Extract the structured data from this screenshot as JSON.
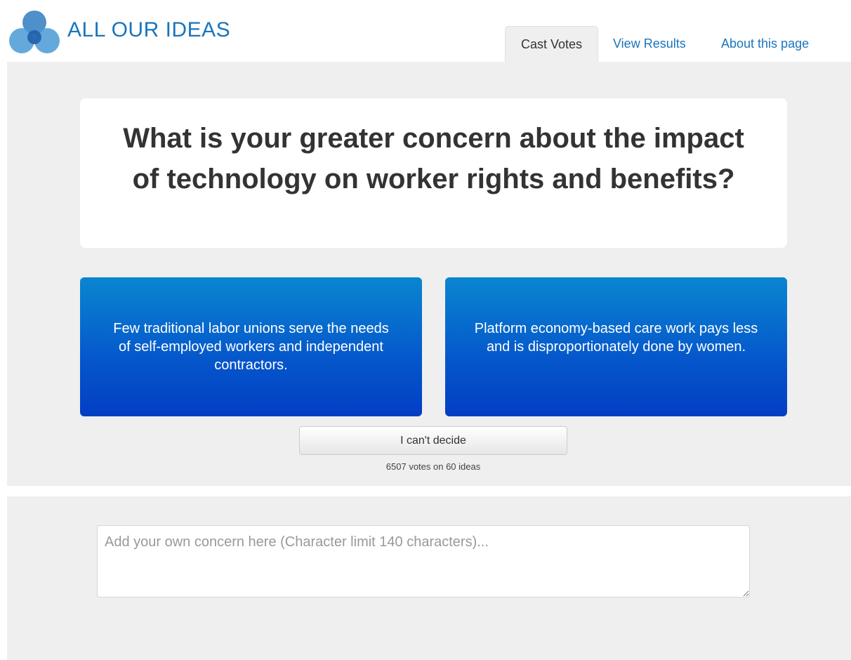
{
  "header": {
    "brand": "ALL OUR IDEAS",
    "logo_icon": "trefoil-logo-icon",
    "tabs": {
      "cast_votes": "Cast Votes",
      "view_results": "View Results",
      "about": "About this page"
    }
  },
  "question": {
    "text": "What is your greater concern about the impact of technology on worker rights and benefits?"
  },
  "choices": {
    "left": "Few traditional labor unions serve the needs of self-employed workers and independent contractors.",
    "right": "Platform economy-based care work pays less and is disproportionately done by women."
  },
  "cant_decide_label": "I can't decide",
  "vote_count": "6507 votes on 60 ideas",
  "add_idea": {
    "placeholder": "Add your own concern here (Character limit 140 characters)..."
  },
  "colors": {
    "brand": "#1a75bc",
    "choice_top": "#0a86d0",
    "choice_bottom": "#033ec4",
    "panel_bg": "#efefef"
  }
}
